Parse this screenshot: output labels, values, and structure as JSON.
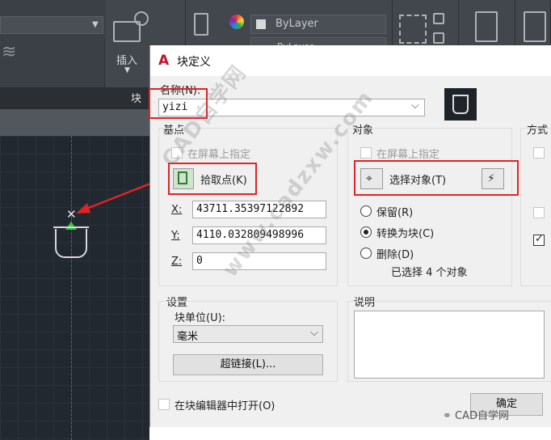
{
  "ribbon": {
    "layer_combo_1": "ByLayer",
    "layer_combo_2": "ByLayer",
    "insert_label": "插入",
    "panel_title": "块"
  },
  "dialog": {
    "title": "块定义",
    "name_label": "名称(N):",
    "name_value": "yizi",
    "base_point": {
      "group_label": "基点",
      "specify_on_screen": "在屏幕上指定",
      "pick_point": "拾取点(K)",
      "x_label": "X:",
      "x_value": "43711.35397122892",
      "y_label": "Y:",
      "y_value": "4110.032809498996",
      "z_label": "Z:",
      "z_value": "0"
    },
    "objects": {
      "group_label": "对象",
      "specify_on_screen": "在屏幕上指定",
      "select_objects": "选择对象(T)",
      "retain": "保留(R)",
      "convert_to_block": "转换为块(C)",
      "delete": "删除(D)",
      "selected_count": "已选择 4 个对象"
    },
    "behavior": {
      "group_label": "方式"
    },
    "settings": {
      "group_label": "设置",
      "block_unit_label": "块单位(U):",
      "block_unit_value": "毫米",
      "hyperlink": "超链接(L)..."
    },
    "description": {
      "group_label": "说明"
    },
    "open_in_editor": "在块编辑器中打开(O)",
    "ok_button": "确定"
  },
  "watermark": {
    "line1": "CAD自学网",
    "line2": "www.cadzxw.com",
    "footer": "CAD自学网"
  },
  "colors": {
    "highlight": "#e02424",
    "canvas": "#212830",
    "ribbon": "#3b3f46"
  }
}
